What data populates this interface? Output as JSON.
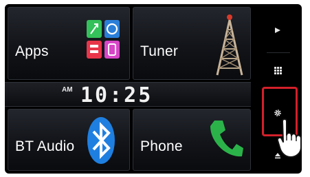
{
  "tiles": {
    "apps": {
      "label": "Apps"
    },
    "tuner": {
      "label": "Tuner"
    },
    "bt_audio": {
      "label": "BT Audio"
    },
    "phone": {
      "label": "Phone"
    }
  },
  "clock": {
    "ampm": "AM",
    "time": "10:25"
  },
  "sidebar": {
    "buttons": [
      {
        "icon": "play-icon"
      },
      {
        "icon": "grid-menu-icon"
      },
      {
        "icon": "gear-icon"
      },
      {
        "icon": "eject-icon"
      }
    ]
  },
  "colors": {
    "highlight": "#d3202a",
    "phone_green": "#2bb34a",
    "bluetooth_blue": "#1f7fe0",
    "tile_dark": "#121419"
  }
}
